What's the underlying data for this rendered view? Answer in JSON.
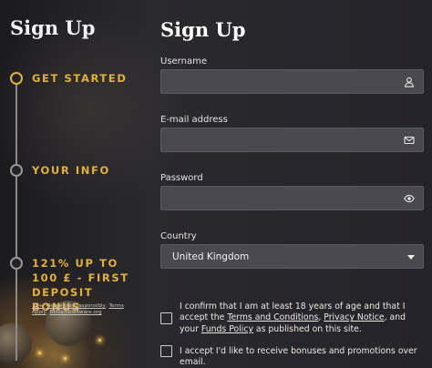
{
  "sidebar": {
    "title": "Sign Up",
    "steps": [
      {
        "label": "GET STARTED",
        "active": true
      },
      {
        "label": "YOUR INFO",
        "active": false
      },
      {
        "label_lines": [
          "121% UP TO",
          "100 £ - FIRST",
          "DEPOSIT BONUS"
        ],
        "active": false
      }
    ],
    "note": {
      "part1": "18+",
      "part2": ", ",
      "link1": "Please play responsibly",
      "part3": ", ",
      "link2": "Terms Apply",
      "part4": ", ",
      "link3": "BeGambleAware.org"
    }
  },
  "form": {
    "title": "Sign Up",
    "username": {
      "label": "Username",
      "value": "",
      "placeholder": "",
      "icon": "user-icon"
    },
    "email": {
      "label": "E-mail address",
      "value": "",
      "placeholder": "",
      "icon": "mail-icon"
    },
    "password": {
      "label": "Password",
      "value": "",
      "placeholder": "",
      "icon": "eye-icon"
    },
    "country": {
      "label": "Country",
      "selected": "United Kingdom",
      "icon": "chevron-down-icon"
    },
    "consent": {
      "text_before": "I confirm that I am at least 18 years of age and that I accept the ",
      "terms_link": "Terms and Conditions",
      "sep1": ", ",
      "privacy_link": "Privacy Notice",
      "sep2": ", and your ",
      "funds_link": "Funds Policy",
      "text_after": " as published on this site.",
      "checked": false
    },
    "bonus_opt_in": {
      "text": "I accept I'd like to receive bonuses and promotions over email.",
      "checked": false
    }
  },
  "colors": {
    "accent": "#e0b13c",
    "field_bg": "#4a4950",
    "page_bg": "#1e1d22"
  }
}
